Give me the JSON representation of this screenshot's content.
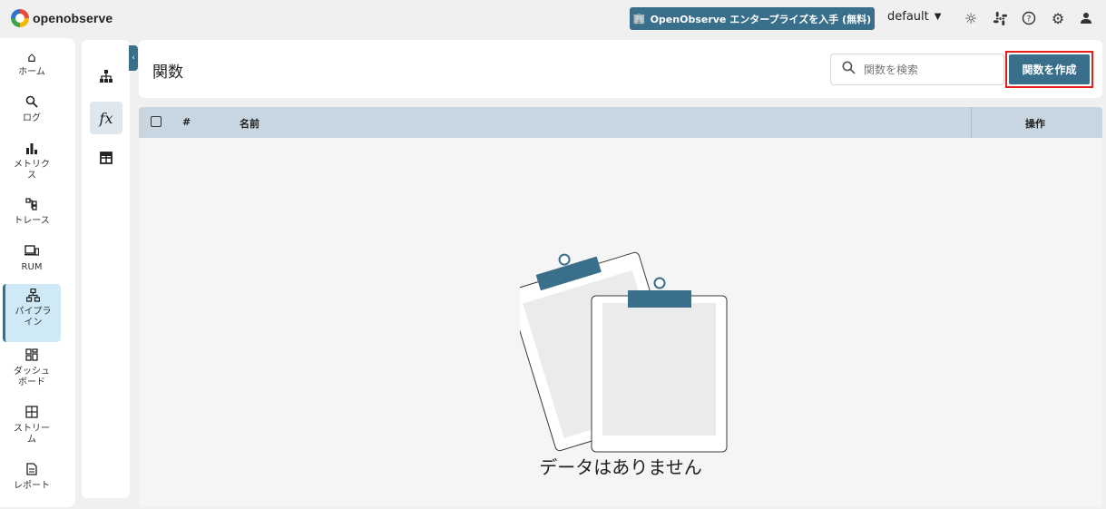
{
  "topbar": {
    "logo_text": "openobserve",
    "enterprise_label": "OpenObserve エンタープライズを入手 (無料)",
    "org": "default",
    "icons": [
      "sun-icon",
      "slack-icon",
      "help-icon",
      "settings-icon",
      "user-icon"
    ]
  },
  "nav": {
    "items": [
      {
        "label": "ホーム",
        "icon": "home-icon"
      },
      {
        "label": "ログ",
        "icon": "search-icon"
      },
      {
        "label": "メトリクス",
        "icon": "bar-chart-icon"
      },
      {
        "label": "トレース",
        "icon": "trace-icon"
      },
      {
        "label": "RUM",
        "icon": "devices-icon"
      },
      {
        "label": "パイプライン",
        "icon": "pipeline-icon"
      },
      {
        "label": "ダッシュボード",
        "icon": "dashboard-icon"
      },
      {
        "label": "ストリーム",
        "icon": "stream-icon"
      },
      {
        "label": "レポート",
        "icon": "report-icon"
      }
    ],
    "active": "パイプライン"
  },
  "subnav": {
    "items": [
      {
        "name": "pipelines",
        "icon": "hierarchy-icon",
        "glyph": "⛼"
      },
      {
        "name": "functions",
        "icon": "function-icon",
        "glyph": "fx"
      },
      {
        "name": "enrichment",
        "icon": "table-icon",
        "glyph": "⊞"
      }
    ],
    "active": "functions"
  },
  "header": {
    "title": "関数",
    "search_placeholder": "関数を検索",
    "create_label": "関数を作成"
  },
  "table": {
    "columns": [
      "#",
      "名前",
      "操作"
    ],
    "rows": [],
    "empty_text": "データはありません"
  },
  "colors": {
    "accent": "#3a6f8c",
    "active_nav_bg": "#cfe9f6",
    "table_header_bg": "#c7d6e0",
    "highlight_border": "#e4201c"
  }
}
